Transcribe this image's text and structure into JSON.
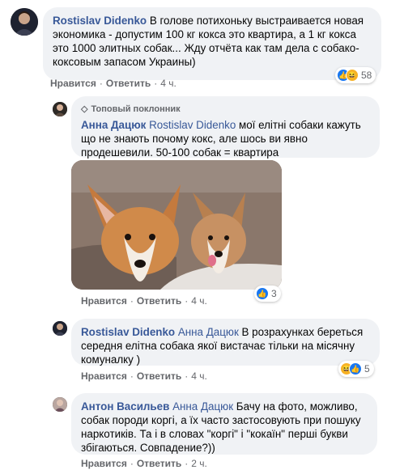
{
  "comments": [
    {
      "author": "Rostislav Didenko",
      "text": " В голове потихоньку выстраивается новая экономика - допустим 100 кг кокса это квартира, а 1 кг кокса это 1000 элитных собак... Жду отчёта как там дела с собако-коксовым запасом Украины)",
      "actions": {
        "like": "Нравится",
        "reply": "Ответить",
        "time": "4 ч."
      },
      "reaction_count": "58"
    },
    {
      "badge": "Топовый поклонник",
      "author": "Анна Дацюк",
      "mention": "Rostislav Didenko",
      "text": " мої елітні собаки кажуть що не знають почому кокс, але шось ви явно продешевили. 50-100 собак = квартира",
      "actions": {
        "like": "Нравится",
        "reply": "Ответить",
        "time": "4 ч."
      },
      "reaction_count": "3"
    },
    {
      "author": "Rostislav Didenko",
      "mention": "Анна Дацюк",
      "text": " В розрахунках береться середня елітна собака якої вистачає тільки на місячну комуналку )",
      "actions": {
        "like": "Нравится",
        "reply": "Ответить",
        "time": "4 ч."
      },
      "reaction_count": "5"
    },
    {
      "author": "Антон Васильев",
      "mention": "Анна Дацюк",
      "text": " Бачу на фото, можливо, собак породи коргі, а їх часто застосовують при пошуку наркотиків. Та і в словах \"коргі\" і \"кокаїн\" перші букви збігаються. Совпадение?))",
      "actions": {
        "like": "Нравится",
        "reply": "Ответить",
        "time": "2 ч."
      }
    }
  ],
  "colors": {
    "bubble": "#f0f2f5",
    "link": "#385898",
    "meta": "#65676b",
    "like": "#1877f2",
    "haha": "#f7b125"
  }
}
